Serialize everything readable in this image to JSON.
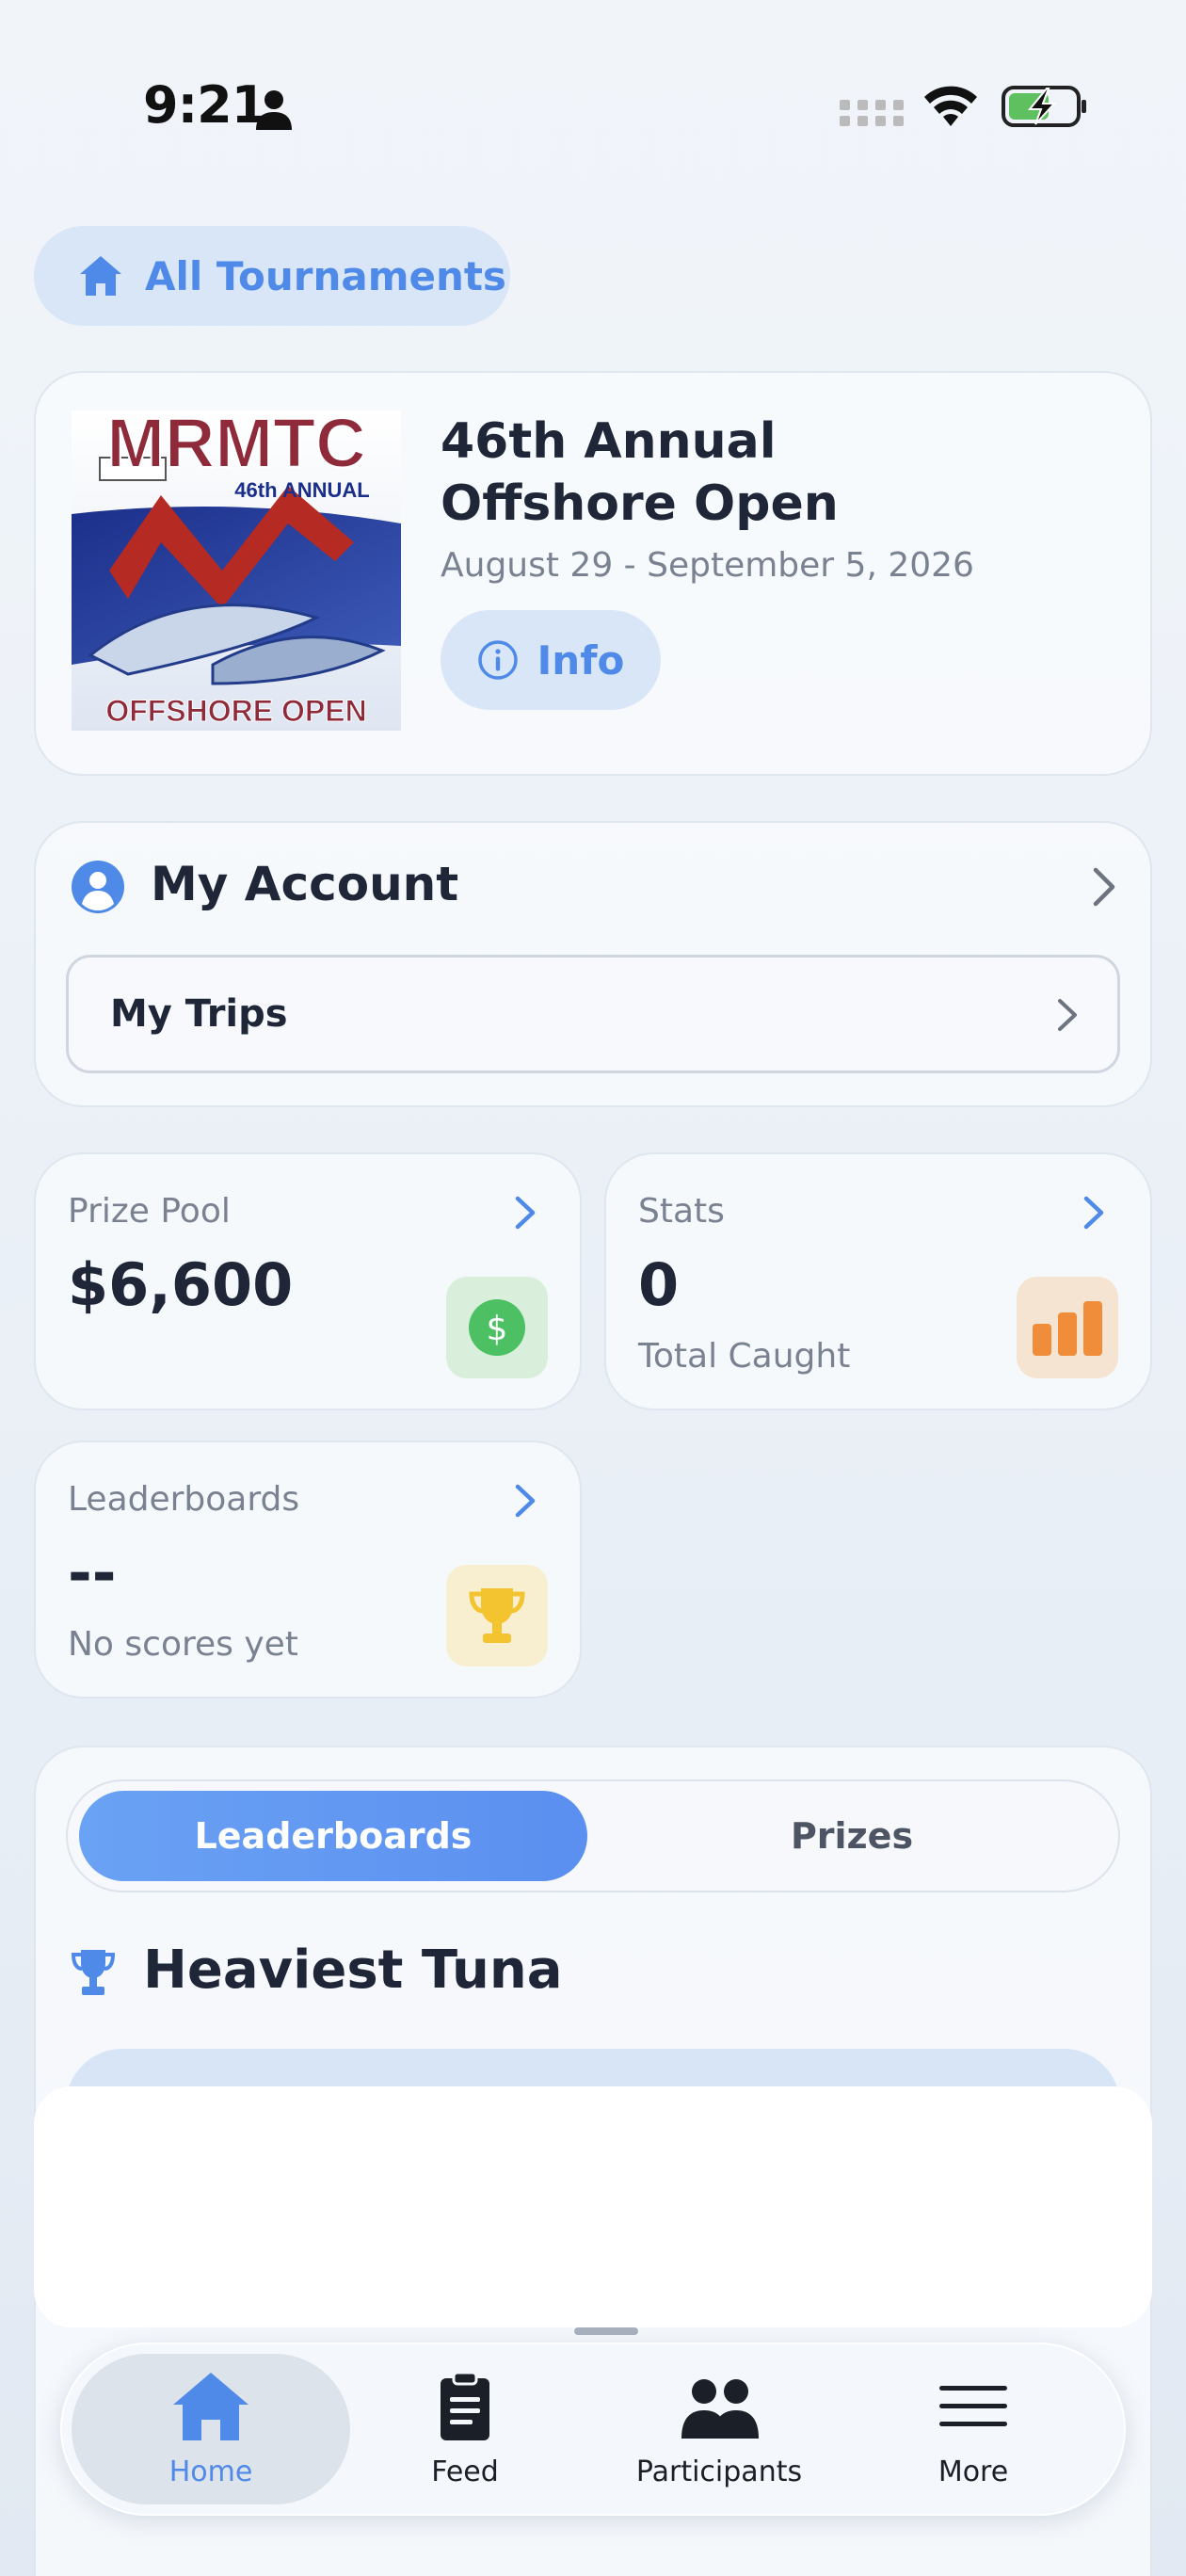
{
  "status_bar": {
    "time": "9:21"
  },
  "nav_top": {
    "back_label": "All Tournaments"
  },
  "tournament": {
    "logo_text": "MRMTC",
    "logo_subtitle": "46th ANNUAL",
    "logo_footer": "OFFSHORE OPEN",
    "title_line1": "46th Annual",
    "title_line2": "Offshore Open",
    "dates": "August 29 - September 5, 2026",
    "info_label": "Info"
  },
  "account": {
    "title": "My Account",
    "trips_label": "My Trips"
  },
  "stats": {
    "prize_pool": {
      "label": "Prize Pool",
      "value": "$6,600",
      "color": "#4cc063"
    },
    "stats": {
      "label": "Stats",
      "value": "0",
      "sub": "Total Caught",
      "color": "#ef8d3a"
    },
    "leaderboards": {
      "label": "Leaderboards",
      "value": "--",
      "sub": "No scores yet",
      "color": "#f4c430"
    }
  },
  "tabs": {
    "active": "Leaderboards",
    "inactive": "Prizes"
  },
  "section": {
    "title": "Heaviest Tuna"
  },
  "bottom_nav": {
    "items": [
      {
        "label": "Home",
        "icon": "home-icon",
        "active": true
      },
      {
        "label": "Feed",
        "icon": "clipboard-icon",
        "active": false
      },
      {
        "label": "Participants",
        "icon": "people-icon",
        "active": false
      },
      {
        "label": "More",
        "icon": "menu-icon",
        "active": false
      }
    ]
  },
  "colors": {
    "accent": "#4f8ae8",
    "accent_light": "#d8e6f8",
    "text_dark": "#1e2638",
    "text_muted": "#7a8190"
  }
}
